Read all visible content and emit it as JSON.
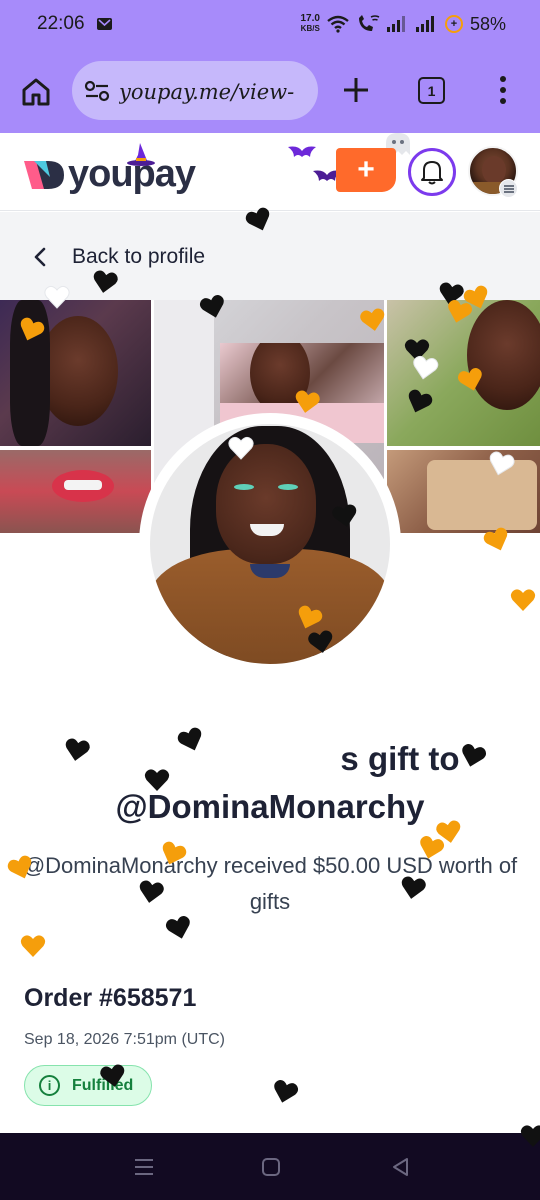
{
  "status_bar": {
    "time": "22:06",
    "net_speed_value": "17.0",
    "net_speed_unit": "KB/S",
    "battery": "58%"
  },
  "browser": {
    "url": "youpay.me/view-",
    "tab_count": "1",
    "icons": [
      "home-icon",
      "tune-icon",
      "plus-icon",
      "tabs-icon",
      "more-vert-icon"
    ]
  },
  "header": {
    "brand": "youpay",
    "create_label": "+",
    "icons": [
      "bell-icon",
      "avatar-menu-icon"
    ]
  },
  "back": {
    "label": "Back to profile"
  },
  "gift": {
    "title_line1": "s gift to",
    "title_line2": "@DominaMonarchy",
    "description": "@DominaMonarchy received $50.00 USD worth of gifts"
  },
  "order": {
    "title": "Order #658571",
    "date": "Sep 18, 2026 7:51pm (UTC)",
    "status": "Fulfilled",
    "status_color": "#15803d"
  },
  "colors": {
    "browser_chrome": "#a78bfa",
    "brand_accent": "#7c3aed",
    "create_button": "#ff6a2b",
    "heart_orange": "#f59e0b",
    "heart_black": "#111111"
  },
  "nav": {
    "icons": [
      "recents-icon",
      "home-circle-icon",
      "back-triangle-icon"
    ]
  }
}
